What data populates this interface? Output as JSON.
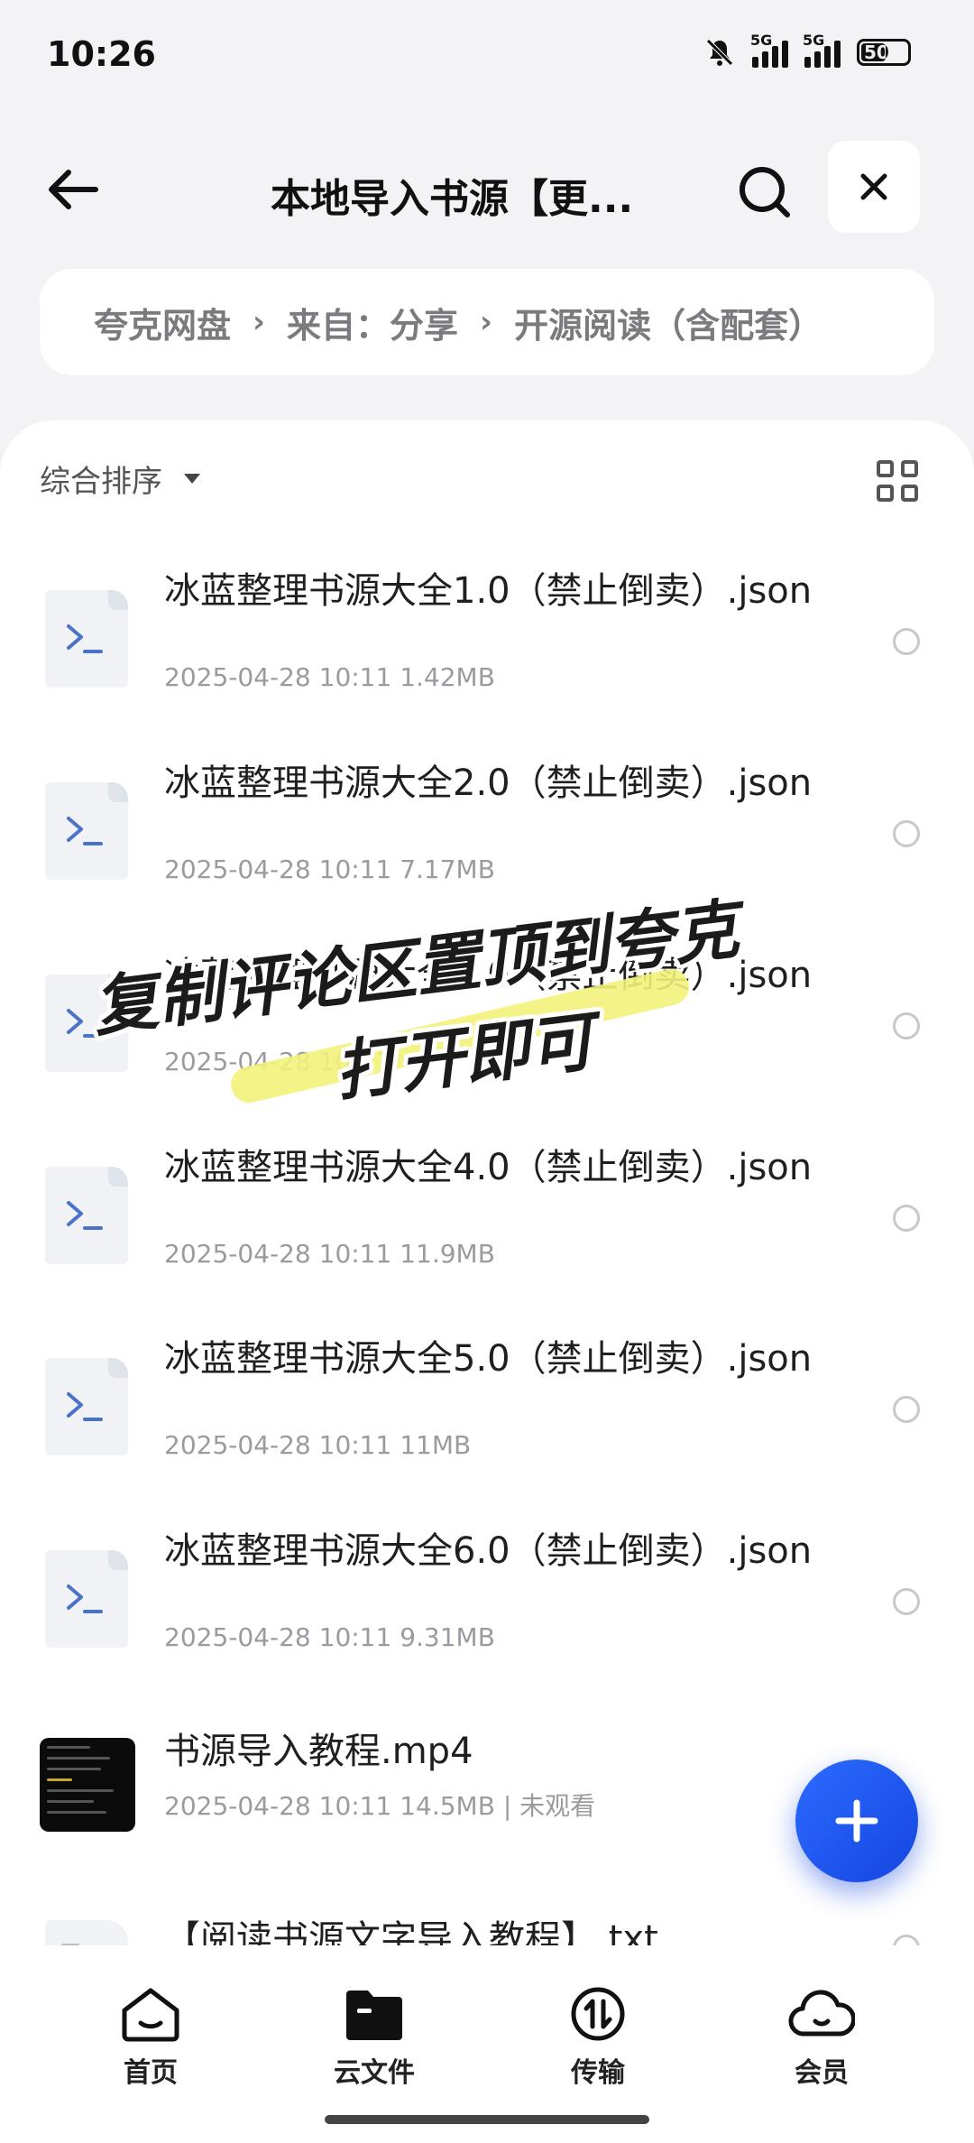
{
  "status_bar": {
    "time": "10:26",
    "signal1_label": "5G",
    "signal2_label": "5G",
    "battery": "50"
  },
  "header": {
    "title": "本地导入书源【更..."
  },
  "breadcrumb": [
    "夸克网盘",
    "来自：分享",
    "开源阅读（含配套）"
  ],
  "sort": {
    "label": "综合排序"
  },
  "files": [
    {
      "name": "冰蓝整理书源大全1.0（禁止倒卖）.json",
      "meta": "2025-04-28 10:11  1.42MB"
    },
    {
      "name": "冰蓝整理书源大全2.0（禁止倒卖）.json",
      "meta": "2025-04-28 10:11  7.17MB"
    },
    {
      "name": "冰蓝整理书源大全3.0（禁止倒卖）.json",
      "meta": "2025-04-28 10:11"
    },
    {
      "name": "冰蓝整理书源大全4.0（禁止倒卖）.json",
      "meta": "2025-04-28 10:11  11.9MB"
    },
    {
      "name": "冰蓝整理书源大全5.0（禁止倒卖）.json",
      "meta": "2025-04-28 10:11  11MB"
    },
    {
      "name": "冰蓝整理书源大全6.0（禁止倒卖）.json",
      "meta": "2025-04-28 10:11  9.31MB"
    },
    {
      "name": "书源导入教程.mp4",
      "meta": "2025-04-28 10:11  14.5MB | 未观看"
    },
    {
      "name": "【阅读书源文字导入教程】.txt",
      "meta": ""
    }
  ],
  "overlay": {
    "line1": "复制评论区置顶到夸克",
    "line2": "打开即可"
  },
  "tabs": [
    "首页",
    "云文件",
    "传输",
    "会员"
  ],
  "colors": {
    "accent": "#1f5cf2",
    "highlighter": "#f3f27a"
  }
}
